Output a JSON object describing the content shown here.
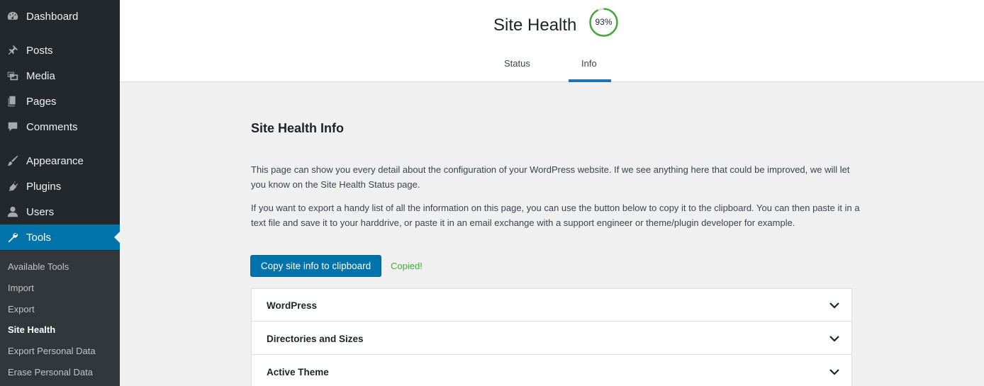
{
  "sidebar": {
    "items": [
      {
        "label": "Dashboard",
        "icon": "dashboard-icon"
      },
      {
        "label": "Posts",
        "icon": "pin-icon"
      },
      {
        "label": "Media",
        "icon": "media-icon"
      },
      {
        "label": "Pages",
        "icon": "pages-icon"
      },
      {
        "label": "Comments",
        "icon": "comment-icon"
      },
      {
        "label": "Appearance",
        "icon": "brush-icon"
      },
      {
        "label": "Plugins",
        "icon": "plugin-icon"
      },
      {
        "label": "Users",
        "icon": "user-icon"
      },
      {
        "label": "Tools",
        "icon": "wrench-icon",
        "active": true
      }
    ],
    "submenu": [
      "Available Tools",
      "Import",
      "Export",
      "Site Health",
      "Export Personal Data",
      "Erase Personal Data"
    ],
    "current_submenu": "Site Health"
  },
  "header": {
    "title": "Site Health",
    "score": "93%",
    "score_value": 93,
    "tabs": [
      "Status",
      "Info"
    ],
    "active_tab": "Info"
  },
  "main": {
    "section_title": "Site Health Info",
    "paragraph1": "This page can show you every detail about the configuration of your WordPress website. If we see anything here that could be improved, we will let you know on the Site Health Status page.",
    "paragraph2": "If you want to export a handy list of all the information on this page, you can use the button below to copy it to the clipboard. You can then paste it in a text file and save it to your harddrive, or paste it in an email exchange with a support engineer or theme/plugin developer for example.",
    "copy_button": "Copy site info to clipboard",
    "copied_text": "Copied!",
    "accordion": [
      "WordPress",
      "Directories and Sizes",
      "Active Theme"
    ]
  },
  "colors": {
    "sidebar_bg": "#23282d",
    "accent": "#0073aa",
    "success": "#46a83a"
  }
}
